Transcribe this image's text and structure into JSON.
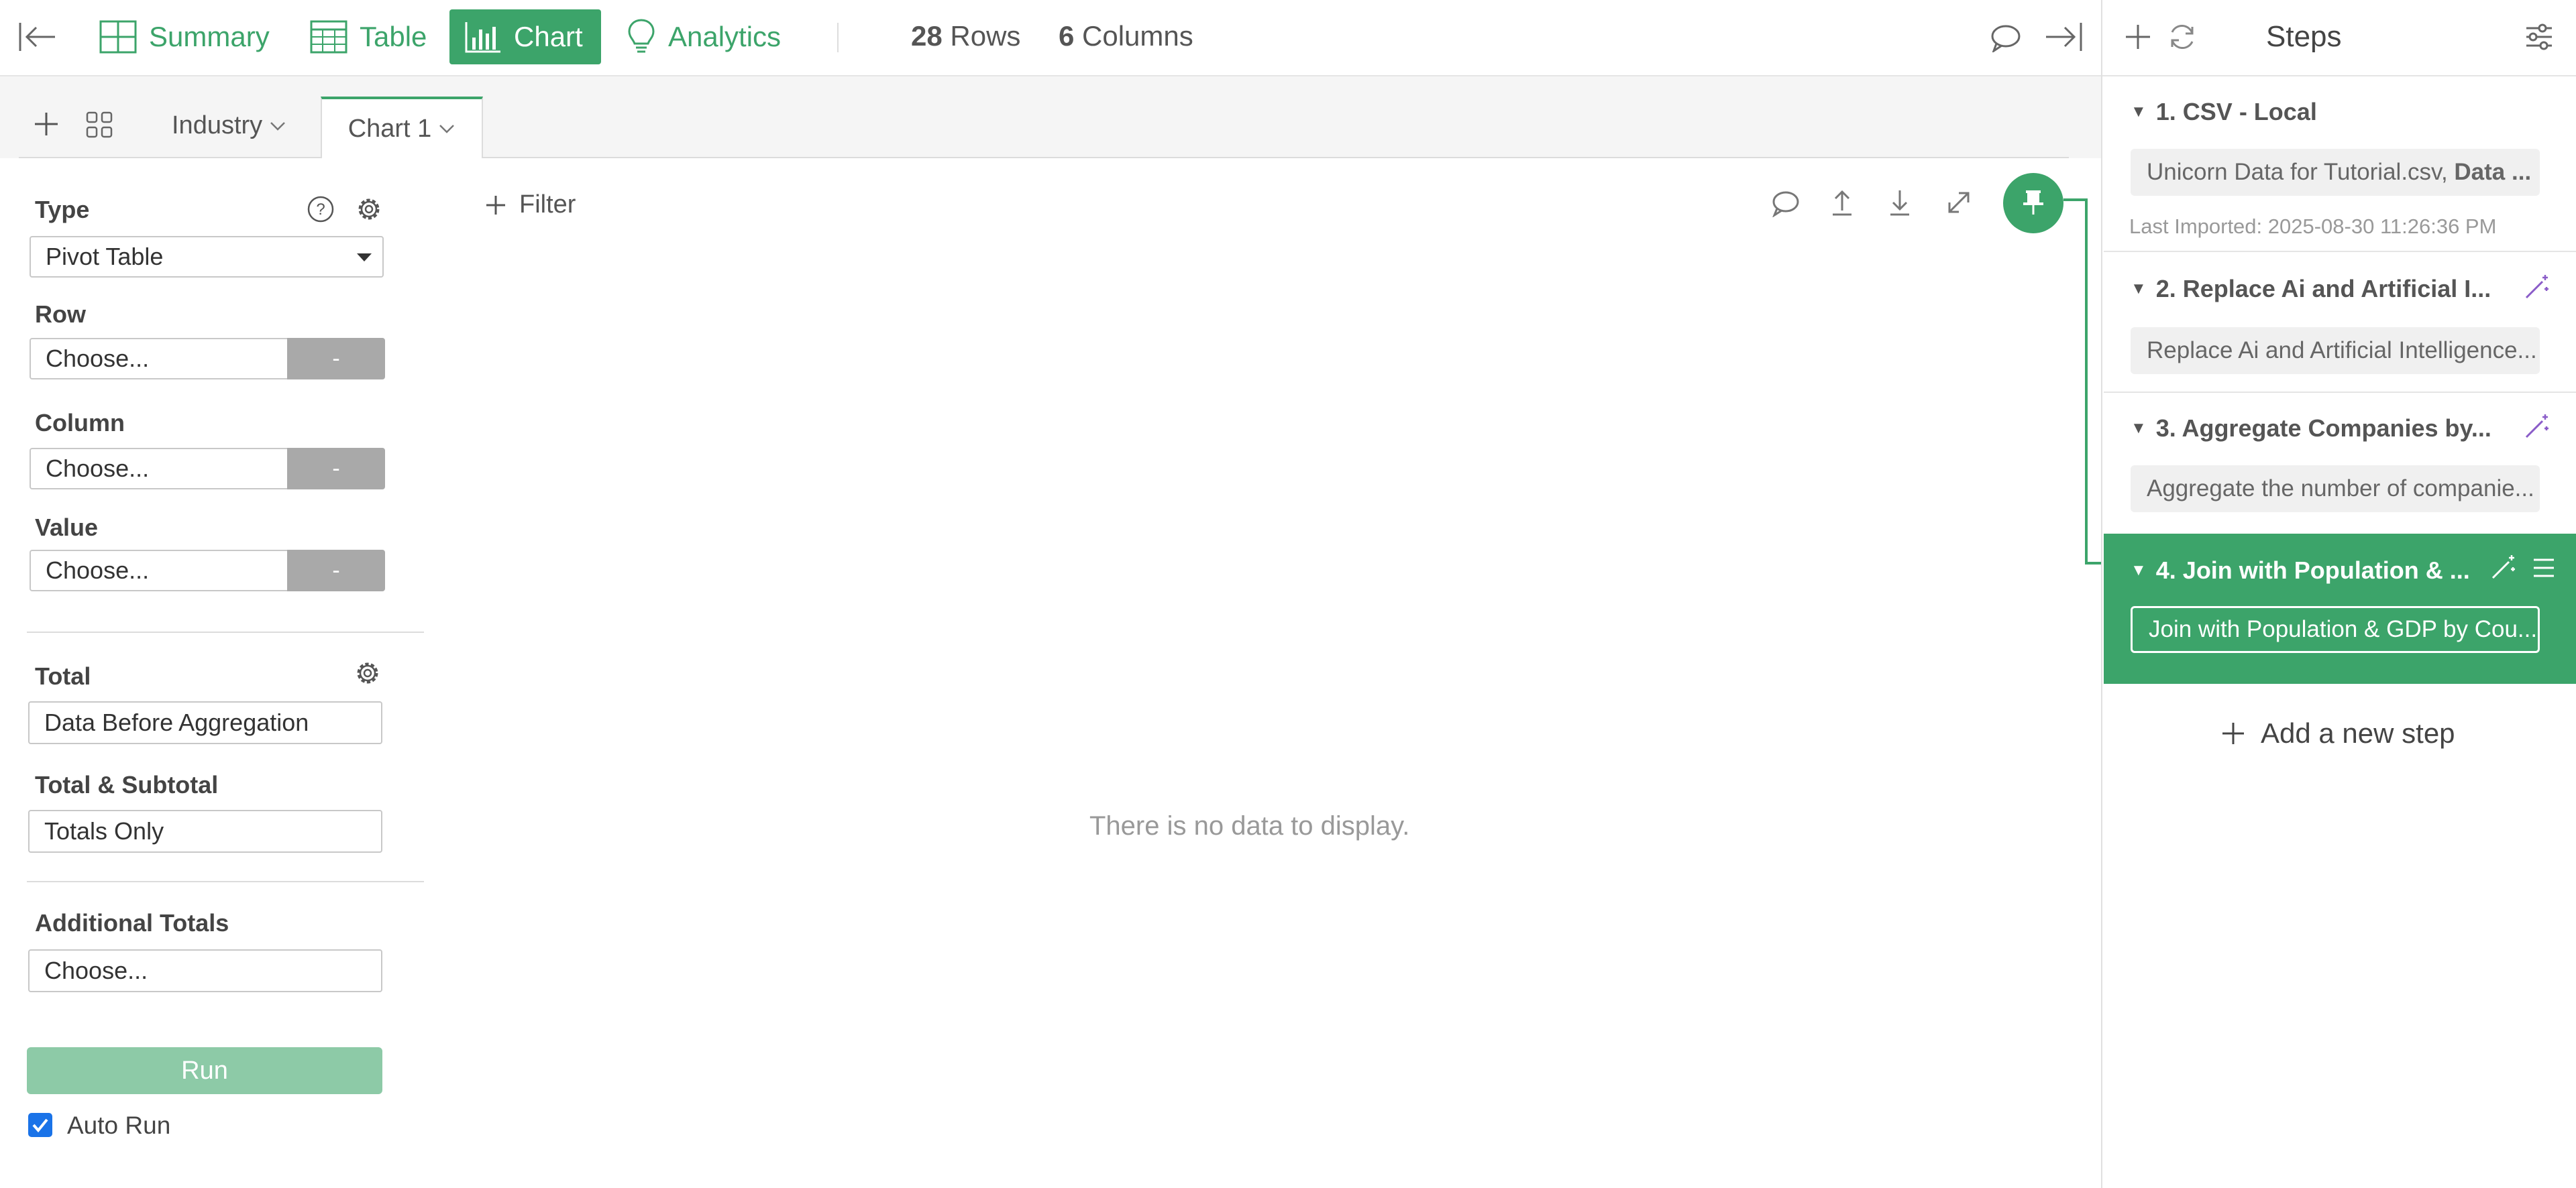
{
  "toolbar": {
    "tabs": [
      {
        "label": "Summary",
        "icon": "summary-icon"
      },
      {
        "label": "Table",
        "icon": "table-icon"
      },
      {
        "label": "Chart",
        "icon": "chart-icon"
      },
      {
        "label": "Analytics",
        "icon": "analytics-bulb-icon"
      }
    ],
    "active_tab": "Chart",
    "rows_count": "28",
    "rows_label": "Rows",
    "columns_count": "6",
    "columns_label": "Columns"
  },
  "chart_tabs": [
    {
      "label": "Industry"
    },
    {
      "label": "Chart 1"
    }
  ],
  "config": {
    "type_label": "Type",
    "type_value": "Pivot Table",
    "row_label": "Row",
    "row_placeholder": "Choose...",
    "column_label": "Column",
    "column_placeholder": "Choose...",
    "value_label": "Value",
    "value_placeholder": "Choose...",
    "dash_label": "-",
    "total_label": "Total",
    "total_value": "Data Before Aggregation",
    "subtotal_label": "Total & Subtotal",
    "subtotal_value": "Totals Only",
    "additional_label": "Additional Totals",
    "additional_placeholder": "Choose...",
    "run_label": "Run",
    "autorun_label": "Auto Run",
    "autorun_checked": true
  },
  "chart_area": {
    "filter_label": "Filter",
    "empty_message": "There is no data to display."
  },
  "steps_panel": {
    "title": "Steps",
    "steps": [
      {
        "title": "1. CSV - Local",
        "desc_prefix": "Unicorn Data for Tutorial.csv, ",
        "desc_bold": "Data ...",
        "meta": "Last Imported: 2025-08-30 11:26:36 PM"
      },
      {
        "title": "2. Replace Ai and Artificial I...",
        "desc": "Replace Ai and Artificial Intelligence..."
      },
      {
        "title": "3. Aggregate Companies by...",
        "desc": "Aggregate the number of companie..."
      },
      {
        "title": "4. Join with Population & ...",
        "desc": "Join with Population & GDP by Cou..."
      }
    ],
    "add_step_label": "Add a new step"
  },
  "colors": {
    "accent": "#3ca46a",
    "run_button": "#8dcaa7",
    "dash_button": "#a9a9a9",
    "wand": "#8a5cc8"
  }
}
